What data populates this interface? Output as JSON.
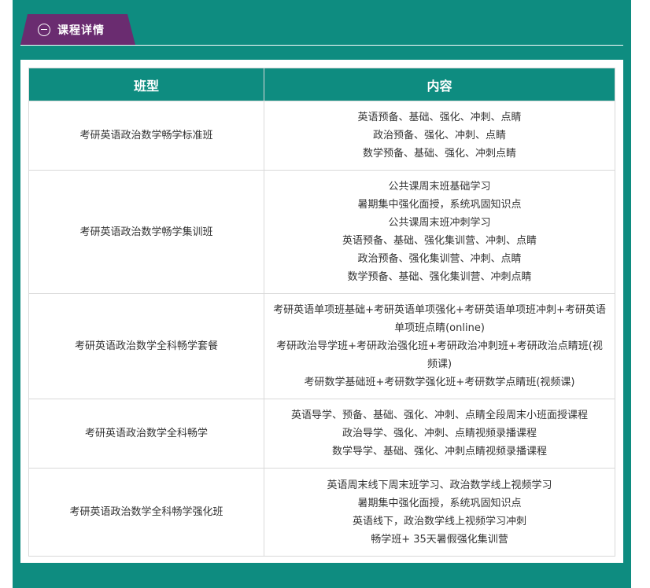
{
  "section": {
    "title": "课程详情"
  },
  "table": {
    "headers": [
      "班型",
      "内容"
    ],
    "rows": [
      {
        "name": "考研英语政治数学畅学标准班",
        "lines": [
          "英语预备、基础、强化、冲刺、点睛",
          "政治预备、强化、冲刺、点睛",
          "数学预备、基础、强化、冲刺点睛"
        ]
      },
      {
        "name": "考研英语政治数学畅学集训班",
        "lines": [
          "公共课周末班基础学习",
          "暑期集中强化面授，系统巩固知识点",
          "公共课周末班冲刺学习",
          "英语预备、基础、强化集训营、冲刺、点睛",
          "政治预备、强化集训营、冲刺、点睛",
          "数学预备、基础、强化集训营、冲刺点睛"
        ]
      },
      {
        "name": "考研英语政治数学全科畅学套餐",
        "lines": [
          "考研英语单项班基础+考研英语单项强化+考研英语单项班冲刺+考研英语单项班点睛(online)",
          "考研政治导学班+考研政治强化班+考研政治冲刺班+考研政治点睛班(视频课)",
          "考研数学基础班+考研数学强化班+考研数学点睛班(视频课)"
        ]
      },
      {
        "name": "考研英语政治数学全科畅学",
        "lines": [
          "英语导学、预备、基础、强化、冲刺、点睛全段周末小班面授课程",
          "政治导学、强化、冲刺、点睛视频录播课程",
          "数学导学、基础、强化、冲刺点睛视频录播课程"
        ]
      },
      {
        "name": "考研英语政治数学全科畅学强化班",
        "lines": [
          "英语周末线下周末班学习、政治数学线上视频学习",
          "暑期集中强化面授，系统巩固知识点",
          "英语线下，政治数学线上视频学习冲刺",
          "畅学班+ 35天暑假强化集训营"
        ]
      }
    ]
  },
  "colors": {
    "teal": "#0e8c80",
    "purple": "#6a2c70",
    "border": "#d9d9d9",
    "text": "#333333"
  }
}
